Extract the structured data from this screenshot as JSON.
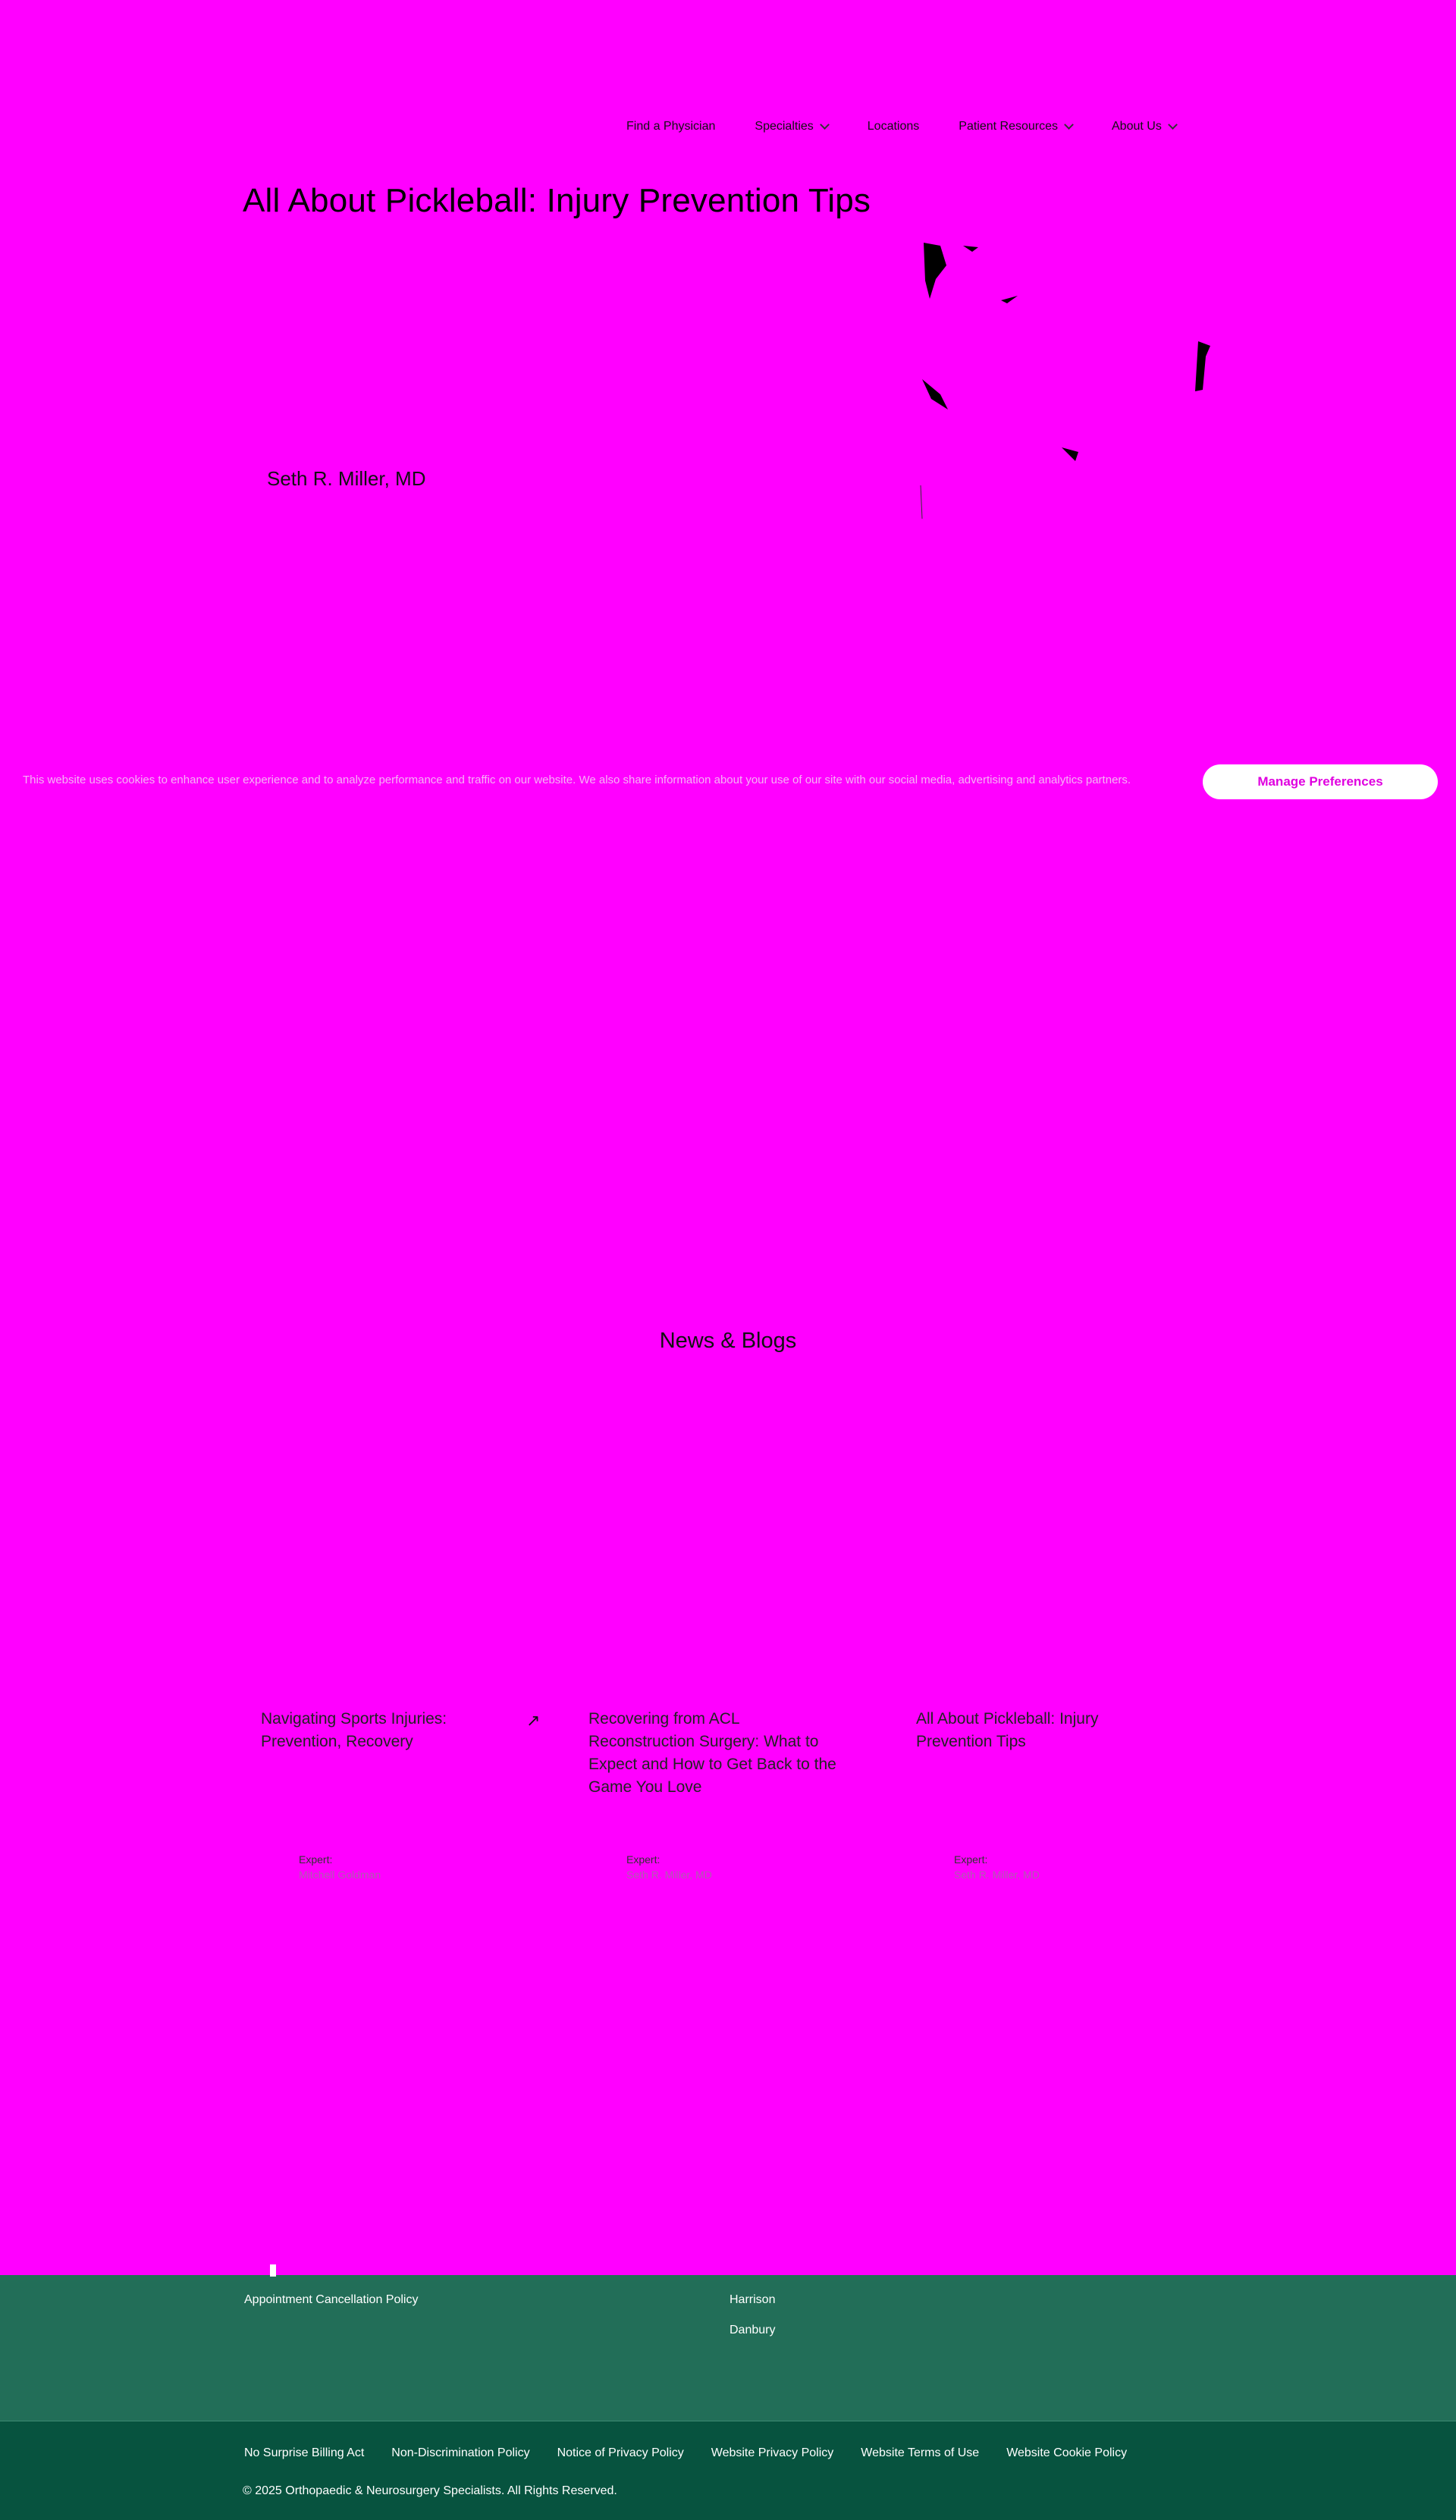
{
  "nav": {
    "items": [
      {
        "label": "Find a Physician",
        "has_dropdown": false
      },
      {
        "label": "Specialties",
        "has_dropdown": true
      },
      {
        "label": "Locations",
        "has_dropdown": false
      },
      {
        "label": "Patient Resources",
        "has_dropdown": true
      },
      {
        "label": "About Us",
        "has_dropdown": true
      }
    ]
  },
  "article": {
    "title": "All About Pickleball: Injury Prevention Tips",
    "author": "Seth R. Miller, MD"
  },
  "cookie_banner": {
    "text": "This website uses cookies to enhance user experience and to analyze performance and traffic on our website. We also share information about your use of our site with our social media, advertising and analytics partners.",
    "manage_label": "Manage Preferences"
  },
  "news": {
    "title": "News & Blogs",
    "cards": [
      {
        "title": "Navigating Sports Injuries: Prevention, Recovery",
        "expert_label": "Expert:",
        "expert_name": "Mitchell Goldman",
        "arrow": "↗"
      },
      {
        "title": "Recovering from ACL Reconstruction Surgery: What to Expect and How to Get Back to the Game You Love",
        "expert_label": "Expert:",
        "expert_name": "Seth R. Miller, MD",
        "arrow": ""
      },
      {
        "title": "All About Pickleball: Injury Prevention Tips",
        "expert_label": "Expert:",
        "expert_name": "Seth R. Miller, MD",
        "arrow": ""
      }
    ]
  },
  "footer": {
    "appointment_policy": "Appointment Cancellation Policy",
    "locations": [
      "Harrison",
      "Danbury"
    ],
    "legal_links": [
      "No Surprise Billing Act",
      "Non-Discrimination Policy",
      "Notice of Privacy Policy",
      "Website Privacy Policy",
      "Website Terms of Use",
      "Website Cookie Policy"
    ],
    "copyright": "© 2025 Orthopaedic & Neurosurgery Specialists. All Rights Reserved."
  },
  "colors": {
    "page_bg": "#ff00ff",
    "footer_top": "#226e58",
    "footer_bottom": "#07533f",
    "button_text": "#e000e0"
  }
}
